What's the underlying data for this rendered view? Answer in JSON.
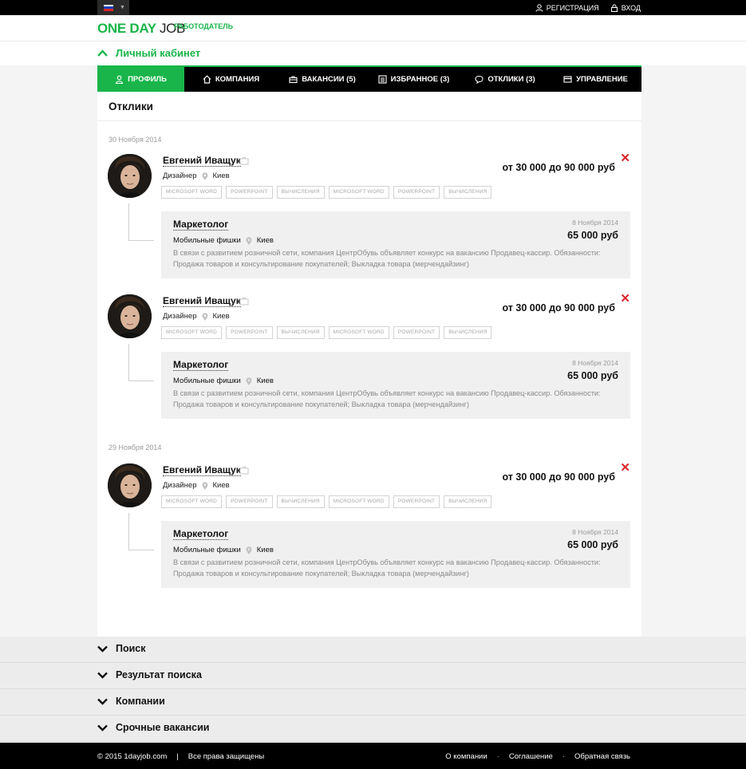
{
  "topbar": {
    "language": "RU",
    "register_label": "РЕГИСТРАЦИЯ",
    "login_label": "ВХОД"
  },
  "header": {
    "logo_part1": "ONE DAY",
    "logo_part2": "JOB",
    "role": "РАБОТОДАТЕЛЬ"
  },
  "cabinet": {
    "title": "Личный кабинет"
  },
  "tabs": [
    {
      "label": "ПРОФИЛЬ",
      "icon": "user-icon",
      "active": true
    },
    {
      "label": "КОМПАНИЯ",
      "icon": "home-icon"
    },
    {
      "label": "ВАКАНСИИ (5)",
      "icon": "briefcase-icon"
    },
    {
      "label": "ИЗБРАННОЕ (3)",
      "icon": "list-icon"
    },
    {
      "label": "ОТКЛИКИ (3)",
      "icon": "chat-icon"
    },
    {
      "label": "УПРАВЛЕНИЕ",
      "icon": "card-icon"
    }
  ],
  "main": {
    "title": "Отклики",
    "dates": [
      "30 Ноября 2014",
      "29 Ноября 2014"
    ],
    "responses": [
      {
        "name": "Евгений Иващук",
        "position": "Дизайнер",
        "city": "Киев",
        "salary": "от 30 000 до 90 000 руб",
        "skills": [
          "MICROSOFT WORD",
          "POWERPOINT",
          "ВЫЧИСЛЕНИЯ",
          "MICROSOFT WORD",
          "POWERPOINT",
          "ВЫЧИСЛЕНИЯ"
        ],
        "vacancy": {
          "title": "Маркетолог",
          "company": "Мобильные фишки",
          "city": "Киев",
          "date": "8 Ноября 2014",
          "price": "65 000 руб",
          "description": "В связи с развитием розничной сети, компания ЦентрОбувь объявляет конкурс на вакансию Продавец-кассир. Обязанности: Продажа товаров и консультирование покупателей; Выкладка товара (мерчендайзинг)"
        }
      },
      {
        "name": "Евгений Иващук",
        "position": "Дизайнер",
        "city": "Киев",
        "salary": "от 30 000 до 90 000 руб",
        "skills": [
          "MICROSOFT WORD",
          "POWERPOINT",
          "ВЫЧИСЛЕНИЯ",
          "MICROSOFT WORD",
          "POWERPOINT",
          "ВЫЧИСЛЕНИЯ"
        ],
        "vacancy": {
          "title": "Маркетолог",
          "company": "Мобильные фишки",
          "city": "Киев",
          "date": "8 Ноября 2014",
          "price": "65 000 руб",
          "description": "В связи с развитием розничной сети, компания ЦентрОбувь объявляет конкурс на вакансию Продавец-кассир. Обязанности: Продажа товаров и консультирование покупателей; Выкладка товара (мерчендайзинг)"
        }
      },
      {
        "name": "Евгений Иващук",
        "position": "Дизайнер",
        "city": "Киев",
        "salary": "от 30 000 до 90 000 руб",
        "skills": [
          "MICROSOFT WORD",
          "POWERPOINT",
          "ВЫЧИСЛЕНИЯ",
          "MICROSOFT WORD",
          "POWERPOINT",
          "ВЫЧИСЛЕНИЯ"
        ],
        "vacancy": {
          "title": "Маркетолог",
          "company": "Мобильные фишки",
          "city": "Киев",
          "date": "8 Ноября 2014",
          "price": "65 000 руб",
          "description": "В связи с развитием розничной сети, компания ЦентрОбувь объявляет конкурс на вакансию Продавец-кассир. Обязанности: Продажа товаров и консультирование покупателей; Выкладка товара (мерчендайзинг)"
        }
      }
    ]
  },
  "accordion": [
    "Поиск",
    "Результат поиска",
    "Компании",
    "Срочные вакансии"
  ],
  "footer": {
    "copyright": "© 2015 1dayjob.com",
    "separator": "|",
    "rights": "Все права защищены",
    "links": [
      "О компании",
      "Соглашение",
      "Обратная связь"
    ],
    "dot": "·"
  },
  "colors": {
    "accent": "#19b54a",
    "remove": "#d8232a"
  }
}
